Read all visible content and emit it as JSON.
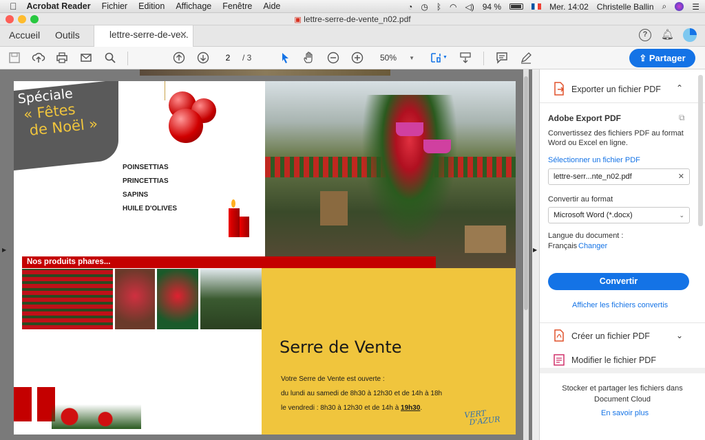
{
  "menubar": {
    "app_name": "Acrobat Reader",
    "items": [
      "Fichier",
      "Edition",
      "Affichage",
      "Fenêtre",
      "Aide"
    ],
    "battery": "94 %",
    "clock": "Mer. 14:02",
    "user": "Christelle Ballin"
  },
  "window": {
    "title": "lettre-serre-de-vente_n02.pdf"
  },
  "tabs": {
    "home": "Accueil",
    "tools": "Outils",
    "document": "lettre-serre-de-ve..."
  },
  "toolbar": {
    "page_current": "2",
    "page_total": "/ 3",
    "zoom": "50%",
    "share_label": "Partager"
  },
  "pdf": {
    "badge_line1": "Spéciale",
    "badge_line2": "« Fêtes",
    "badge_line3": "de Noël »",
    "products": [
      "POINSETTIAS",
      "PRINCETTIAS",
      "SAPINS",
      "HUILE D'OLIVES"
    ],
    "banner": "Nos produits phares...",
    "heading": "Serre de Vente",
    "line1": "Votre Serre de Vente est ouverte :",
    "line2": "du lundi au samedi de 8h30 à 12h30 et de 14h à 18h",
    "line3_prefix": "le vendredi : 8h30 à 12h30 et de 14h à ",
    "line3_time": "19h30",
    "line3_suffix": ".",
    "logo_text_1": "VERT",
    "logo_text_2": "D'AZUR"
  },
  "panel": {
    "export_title": "Exporter un fichier PDF",
    "adobe_export": "Adobe Export PDF",
    "description": "Convertissez des fichiers PDF au format Word ou Excel en ligne.",
    "select_link": "Sélectionner un fichier PDF",
    "file_name": "lettre-serr...nte_n02.pdf",
    "convert_to_label": "Convertir au format",
    "format_value": "Microsoft Word (*.docx)",
    "language_label": "Langue du document :",
    "language_value": "Français",
    "change_link": "Changer",
    "convert_button": "Convertir",
    "view_converted": "Afficher les fichiers convertis",
    "create_pdf": "Créer un fichier PDF",
    "edit_pdf": "Modifier le fichier PDF",
    "cloud_text": "Stocker et partager les fichiers dans Document Cloud",
    "learn_more": "En savoir plus"
  },
  "colors": {
    "accent": "#1473e6",
    "banner_red": "#c40000",
    "pdf_yellow": "#f0c53d"
  }
}
